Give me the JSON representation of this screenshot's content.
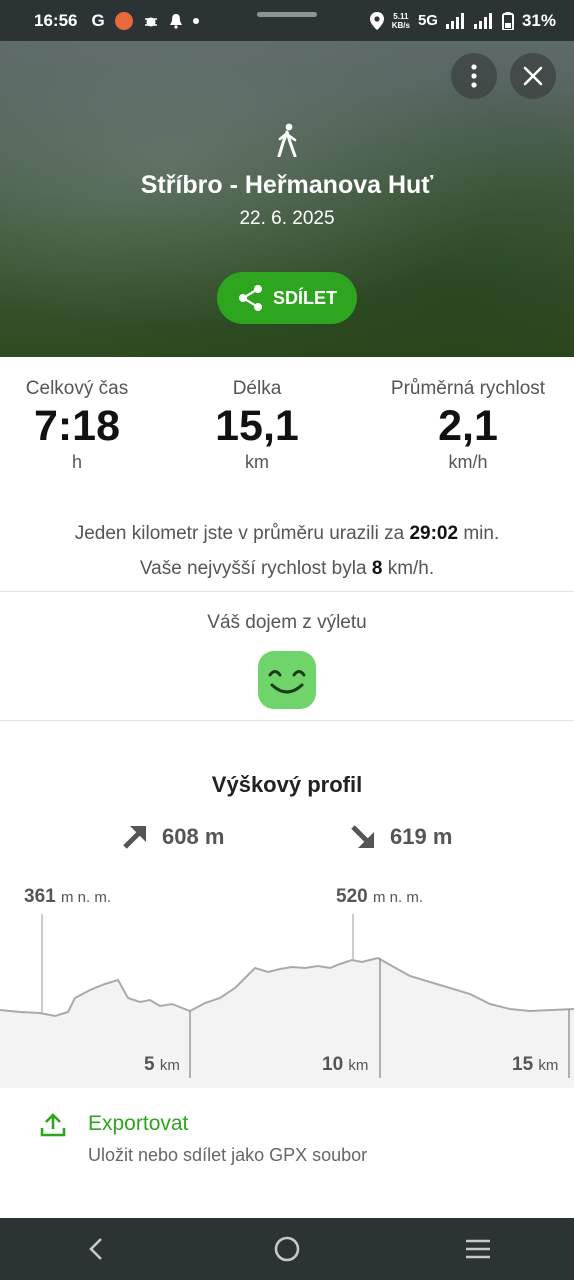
{
  "status_bar": {
    "time": "16:56",
    "g_label": "G",
    "speed_top": "5.11",
    "speed_bottom": "KB/s",
    "network": "5G",
    "battery": "31%"
  },
  "header": {
    "title": "Stříbro - Heřmanova Huť",
    "date": "22. 6. 2025",
    "share_label": "SDÍLET",
    "icons": {
      "more": "more-vertical-icon",
      "close": "close-icon",
      "activity": "walking-icon",
      "share": "share-icon"
    }
  },
  "stats": {
    "time": {
      "label": "Celkový čas",
      "value": "7:18",
      "unit": "h"
    },
    "length": {
      "label": "Délka",
      "value": "15,1",
      "unit": "km"
    },
    "speed": {
      "label": "Průměrná rychlost",
      "value": "2,1",
      "unit": "km/h"
    }
  },
  "pace": {
    "line1_prefix": "Jeden kilometr jste v průměru urazili za",
    "line1_value": "29:02",
    "line1_suffix": "min.",
    "line2_prefix": "Vaše nejvyšší rychlost byla",
    "line2_value": "8",
    "line2_suffix": "km/h."
  },
  "impression": {
    "label": "Váš dojem z výletu",
    "icon": "smiley-face-icon"
  },
  "elevation": {
    "title": "Výškový profil",
    "ascent": "608 m",
    "descent": "619 m",
    "min_value": "361",
    "max_value": "520",
    "altitude_unit": "m n. m.",
    "km_marks": [
      {
        "value": "5",
        "unit": "km"
      },
      {
        "value": "10",
        "unit": "km"
      },
      {
        "value": "15",
        "unit": "km"
      }
    ]
  },
  "export": {
    "title": "Exportovat",
    "subtitle": "Uložit nebo sdílet jako GPX soubor",
    "icon": "upload-icon"
  },
  "navbar": {
    "back": "back-icon",
    "home": "home-icon",
    "menu": "menu-icon"
  },
  "colors": {
    "accent": "#2ea51f",
    "smiley": "#6fd46a",
    "status_bar": "#2c3335"
  }
}
